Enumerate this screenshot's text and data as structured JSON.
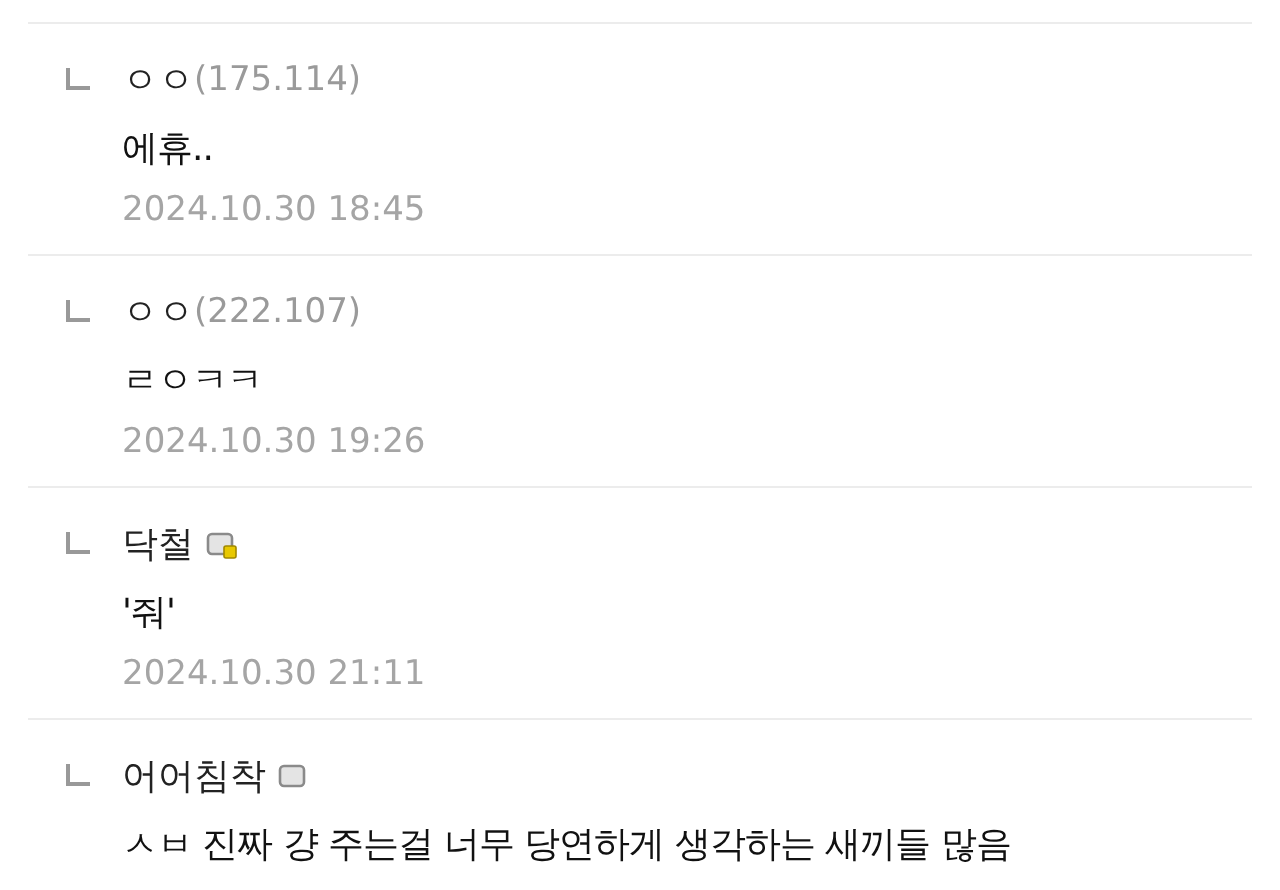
{
  "comments": [
    {
      "kind": "ip",
      "name": "ㅇㅇ",
      "ip": "(175.114)",
      "body": "에휴..",
      "date": "2024.10.30 18:45"
    },
    {
      "kind": "ip",
      "name": "ㅇㅇ",
      "ip": "(222.107)",
      "body": "ㄹㅇㅋㅋ",
      "date": "2024.10.30 19:26"
    },
    {
      "kind": "member",
      "name": "닥철",
      "icon_marked": true,
      "body": "'줘'",
      "date": "2024.10.30 21:11"
    },
    {
      "kind": "member",
      "name": "어어침착",
      "icon_marked": false,
      "body": "ㅅㅂ 진짜 걍 주는걸 너무 당연하게 생각하는 새끼들 많음"
    }
  ]
}
